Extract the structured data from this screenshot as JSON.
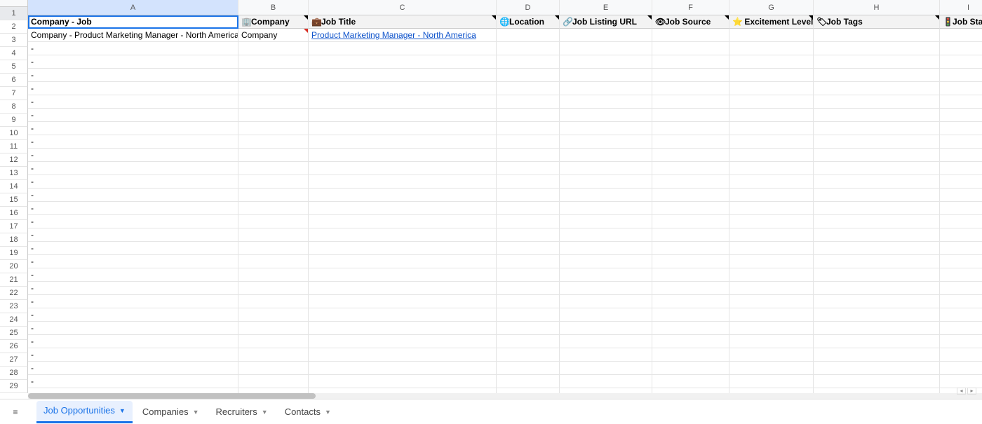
{
  "cols": [
    "A",
    "B",
    "C",
    "D",
    "E",
    "F",
    "G",
    "H",
    "I"
  ],
  "col_widths": [
    "cA",
    "cB",
    "cC",
    "cD",
    "cE",
    "cF",
    "cG",
    "cH",
    "cI"
  ],
  "row_count": 29,
  "active_cell": {
    "row": 1,
    "col": 0
  },
  "header_cells": [
    {
      "icon": "",
      "label": "Company - Job"
    },
    {
      "icon": "🏢",
      "label": "Company"
    },
    {
      "icon": "💼",
      "label": "Job Title"
    },
    {
      "icon": "🌐",
      "label": "Location"
    },
    {
      "icon": "🔗",
      "label": "Job Listing URL"
    },
    {
      "icon": "👁",
      "label": "Job Source"
    },
    {
      "icon": "⭐",
      "label": " Excitement Level"
    },
    {
      "icon": "🏷",
      "label": "Job Tags"
    },
    {
      "icon": "🚦",
      "label": "Job Status"
    }
  ],
  "row2": {
    "a": "Company - Product Marketing Manager - North America",
    "b": "Company",
    "c": "Product Marketing Manager - North America"
  },
  "dash": " - ",
  "tabs": {
    "t1": "Job Opportunities",
    "t2": "Companies",
    "t3": "Recruiters",
    "t4": "Contacts"
  },
  "stray_colon": ":"
}
